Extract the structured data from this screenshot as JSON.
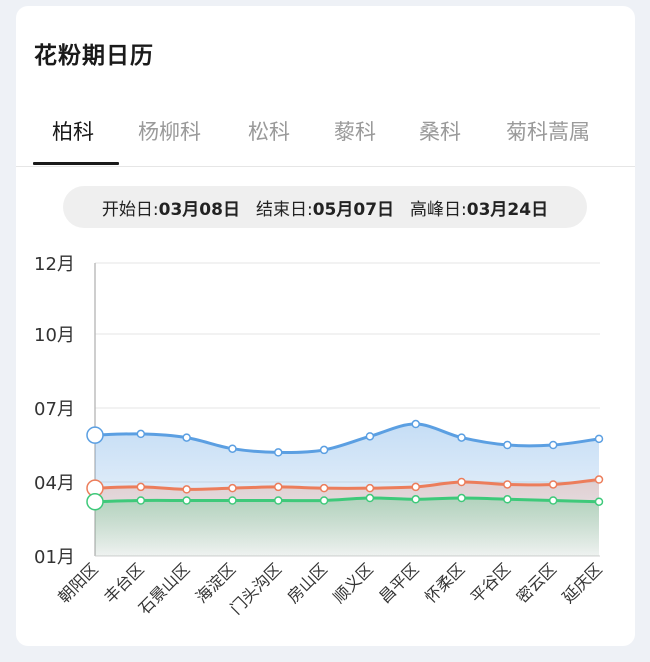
{
  "title": "花粉期日历",
  "tabs": [
    {
      "label": "柏科",
      "active": true
    },
    {
      "label": "杨柳科",
      "active": false
    },
    {
      "label": "松科",
      "active": false
    },
    {
      "label": "藜科",
      "active": false
    },
    {
      "label": "桑科",
      "active": false
    },
    {
      "label": "菊科蒿属",
      "active": false
    }
  ],
  "info": {
    "start_label": "开始日:",
    "start_value": "03月08日",
    "end_label": "结束日:",
    "end_value": "05月07日",
    "peak_label": "高峰日:",
    "peak_value": "03月24日"
  },
  "colors": {
    "blue": "#5b9fe2",
    "orange": "#ec7d5b",
    "green": "#3ec97a"
  },
  "chart_data": {
    "type": "area",
    "categories": [
      "朝阳区",
      "丰台区",
      "石景山区",
      "海淀区",
      "门头沟区",
      "房山区",
      "顺义区",
      "昌平区",
      "怀柔区",
      "平谷区",
      "密云区",
      "延庆区"
    ],
    "y_ticks": [
      "01月",
      "04月",
      "07月",
      "10月",
      "12月"
    ],
    "ylim": [
      1,
      13
    ],
    "series": [
      {
        "values": [
          5.9,
          5.95,
          5.8,
          5.35,
          5.2,
          5.3,
          5.85,
          6.35,
          5.8,
          5.5,
          5.5,
          5.75
        ],
        "color": "#5b9fe2"
      },
      {
        "values": [
          3.75,
          3.8,
          3.7,
          3.75,
          3.8,
          3.75,
          3.75,
          3.8,
          4.0,
          3.9,
          3.9,
          4.1
        ],
        "color": "#ec7d5b"
      },
      {
        "values": [
          3.2,
          3.25,
          3.25,
          3.25,
          3.25,
          3.25,
          3.35,
          3.3,
          3.35,
          3.3,
          3.25,
          3.2
        ],
        "color": "#3ec97a"
      }
    ]
  }
}
